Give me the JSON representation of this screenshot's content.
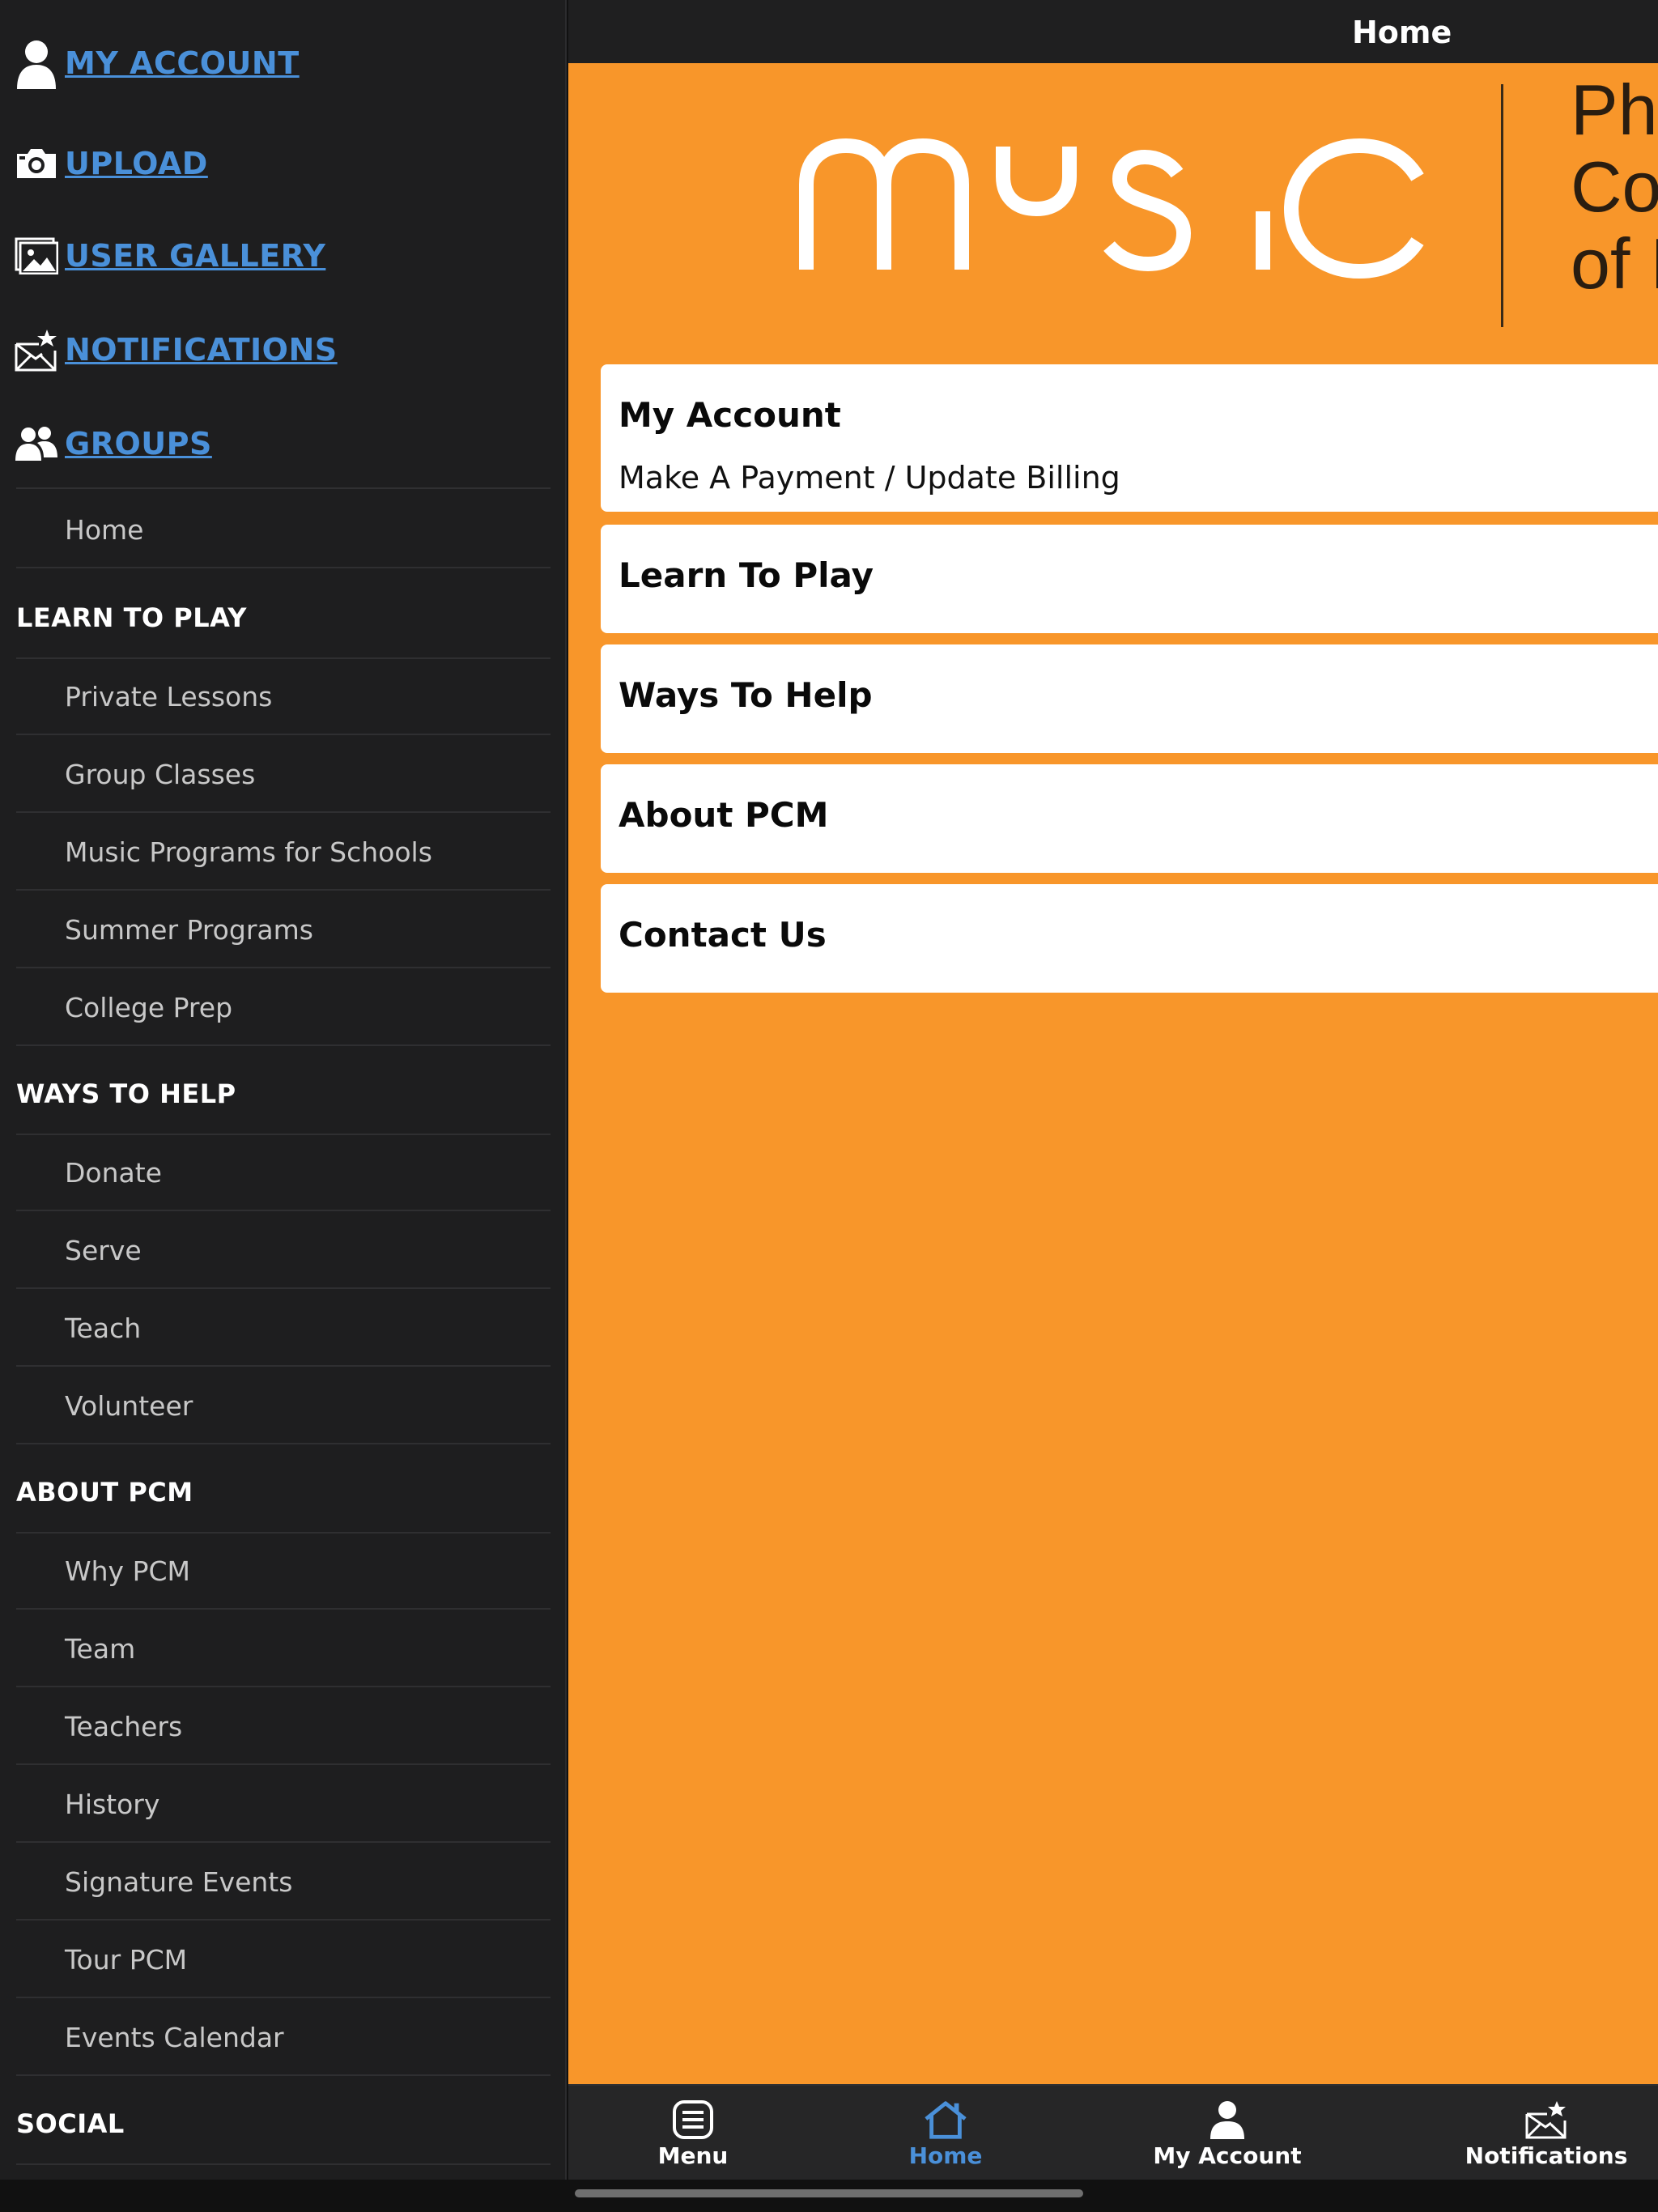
{
  "topbar": {
    "title": "Home"
  },
  "sidebar": {
    "links": [
      {
        "label": "MY ACCOUNT",
        "icon": "user-icon"
      },
      {
        "label": "UPLOAD",
        "icon": "camera-icon"
      },
      {
        "label": "USER GALLERY",
        "icon": "gallery-icon"
      },
      {
        "label": "NOTIFICATIONS",
        "icon": "notifications-icon"
      },
      {
        "label": "GROUPS",
        "icon": "groups-icon"
      }
    ],
    "home": "Home",
    "sections": [
      {
        "header": "LEARN TO PLAY",
        "items": [
          "Private Lessons",
          "Group Classes",
          "Music Programs for Schools",
          "Summer Programs",
          "College Prep"
        ]
      },
      {
        "header": "WAYS TO HELP",
        "items": [
          "Donate",
          "Serve",
          "Teach",
          "Volunteer"
        ]
      },
      {
        "header": "ABOUT PCM",
        "items": [
          "Why PCM",
          "Team",
          "Teachers",
          "History",
          "Signature Events",
          "Tour PCM",
          "Events Calendar"
        ]
      },
      {
        "header": "SOCIAL",
        "items": []
      }
    ]
  },
  "banner": {
    "logo_text": "music",
    "lines": [
      "Pho",
      "Co",
      "of I"
    ]
  },
  "cards": [
    {
      "title": "My Account",
      "subtitle": "Make A Payment / Update Billing"
    },
    {
      "title": "Learn To Play"
    },
    {
      "title": "Ways To Help"
    },
    {
      "title": "About PCM"
    },
    {
      "title": "Contact Us"
    }
  ],
  "tabbar": {
    "tabs": [
      {
        "label": "Menu",
        "icon": "menu-icon",
        "active": false
      },
      {
        "label": "Home",
        "icon": "home-icon",
        "active": true
      },
      {
        "label": "My Account",
        "icon": "account-icon",
        "active": false
      },
      {
        "label": "Notifications",
        "icon": "notifications-icon",
        "active": false
      }
    ]
  },
  "colors": {
    "accent": "#4a90d9",
    "brand_orange": "#f8962a",
    "sidebar_bg": "#1e1e1f",
    "topbar_bg": "#1f1f20"
  }
}
